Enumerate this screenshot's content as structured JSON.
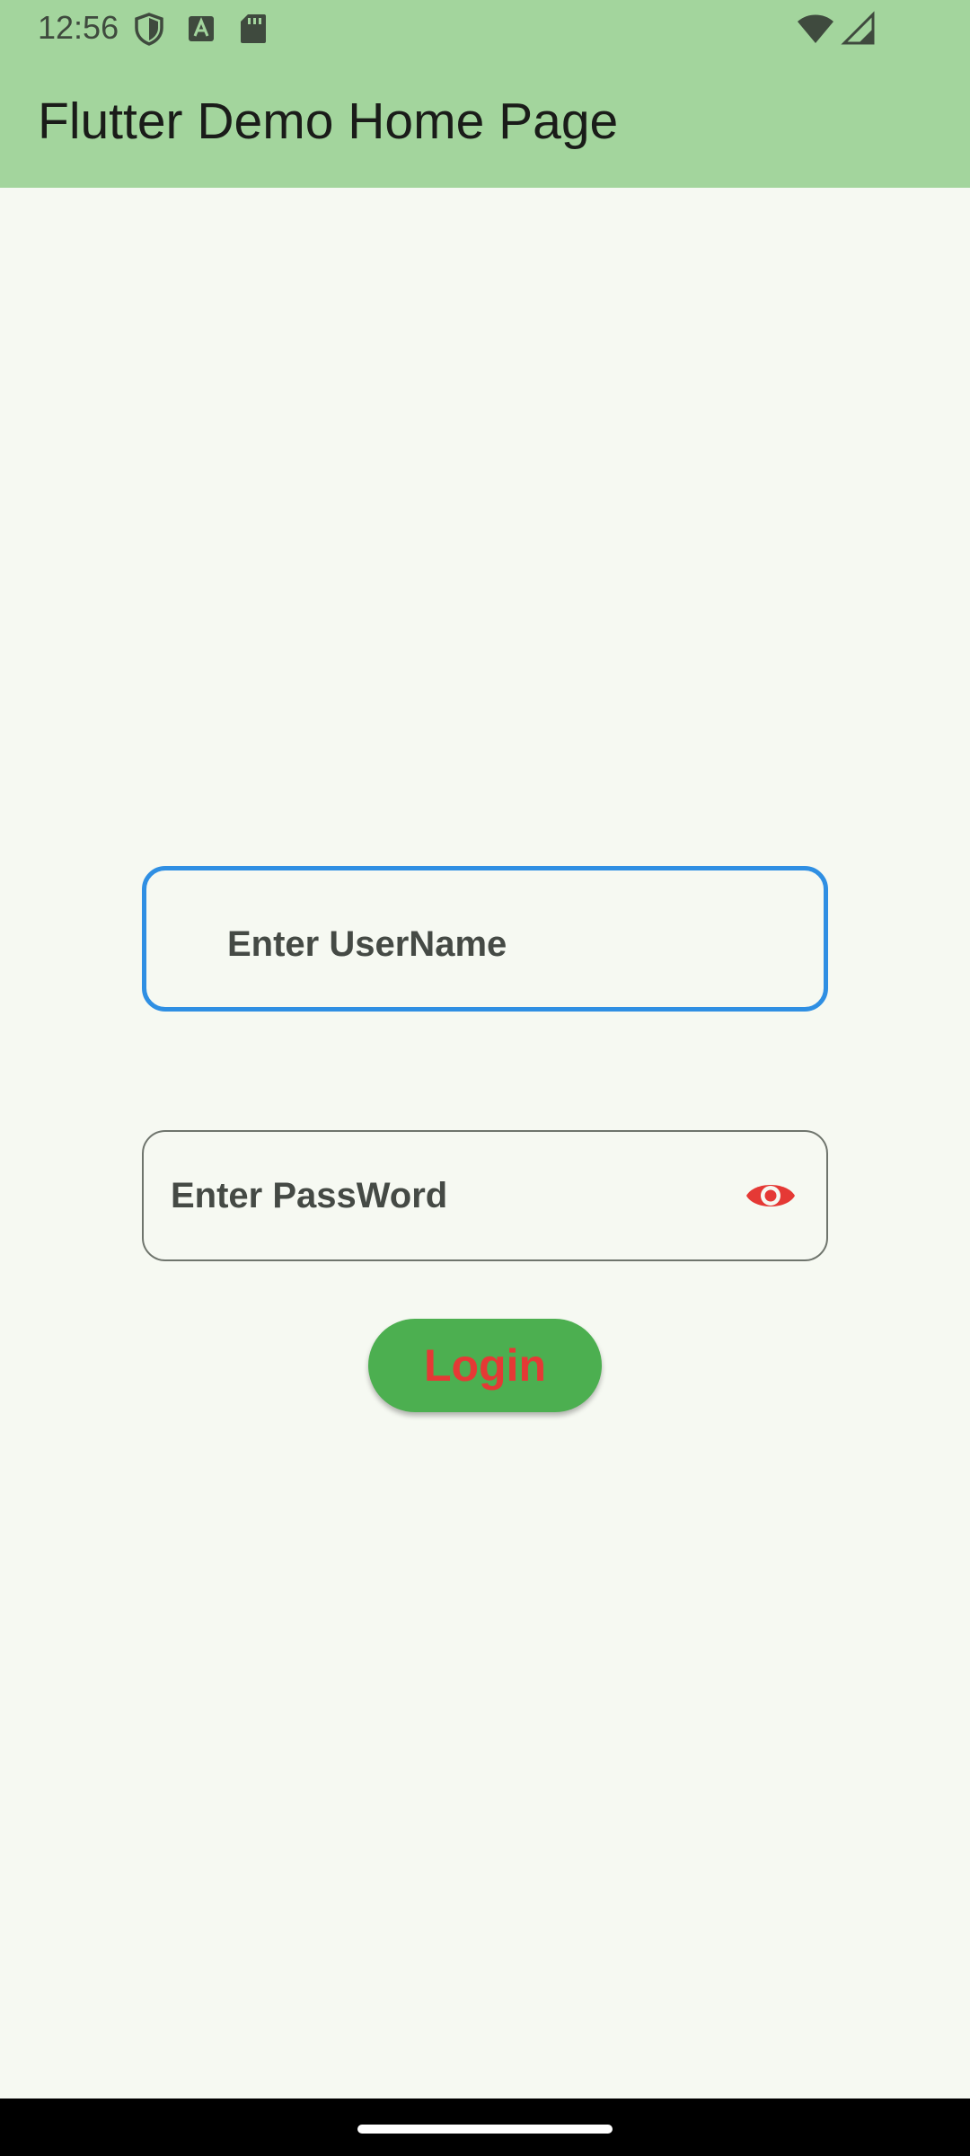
{
  "status_bar": {
    "time": "12:56",
    "icons_left": [
      "shield-icon",
      "font-a-icon",
      "sd-card-icon"
    ],
    "icons_right": [
      "wifi-icon",
      "signal-icon"
    ]
  },
  "app_bar": {
    "title": "Flutter Demo Home Page",
    "color": "#A3D59D"
  },
  "form": {
    "username_placeholder": "Enter UserName",
    "password_placeholder": "Enter PassWord",
    "username_focused": true,
    "password_visibility_icon": "eye-icon",
    "login_label": "Login"
  },
  "colors": {
    "background": "#F6F9F2",
    "focused_border": "#2F8FE3",
    "button": "#4CAF50",
    "button_text": "#E53935",
    "eye_icon": "#E53935"
  }
}
